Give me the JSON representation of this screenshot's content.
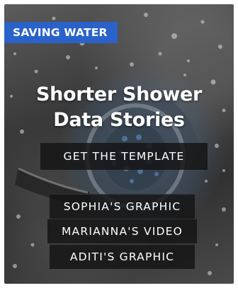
{
  "tag": {
    "label": "SAVING WATER"
  },
  "title": {
    "line1": "Shorter Shower",
    "line2": "Data Stories"
  },
  "buttons": {
    "template": "GET THE TEMPLATE",
    "sophia": "SOPHIA'S GRAPHIC",
    "marianna": "MARIANNA'S VIDEO",
    "aditi": "ADITI'S GRAPHIC"
  },
  "colors": {
    "tag_bg": "#2a62c9",
    "button_bg": "#141414",
    "text": "#ffffff"
  },
  "background": {
    "image": "shower-head-water-spray-photo"
  }
}
